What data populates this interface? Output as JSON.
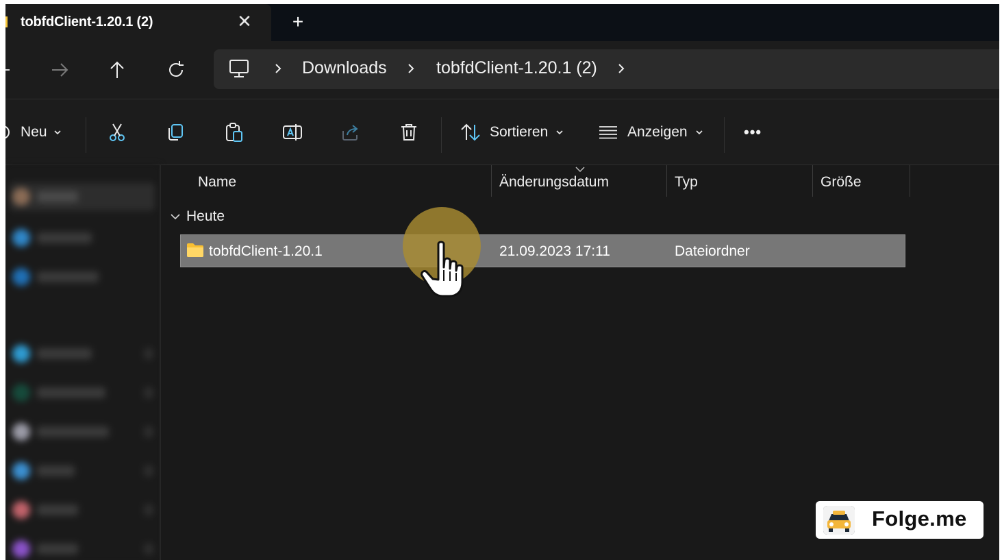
{
  "tab": {
    "title": "tobfdClient-1.20.1 (2)",
    "close_glyph": "✕",
    "new_tab_glyph": "+"
  },
  "breadcrumb": [
    "Downloads",
    "tobfdClient-1.20.1 (2)"
  ],
  "toolbar": {
    "new_label": "Neu",
    "sort_label": "Sortieren",
    "view_label": "Anzeigen",
    "more_glyph": "•••"
  },
  "columns": [
    "Name",
    "Änderungsdatum",
    "Typ",
    "Größe"
  ],
  "group": {
    "label": "Heute"
  },
  "rows": [
    {
      "name": "tobfdClient-1.20.1",
      "modified": "21.09.2023 17:11",
      "type": "Dateiordner",
      "size": ""
    }
  ],
  "watermark": {
    "text": "Folge.me"
  },
  "colors": {
    "background": "#191919",
    "tab_strip": "#0c1016",
    "selection": "#777777",
    "accent_blue": "#4cc2ff",
    "folder_yellow": "#ffc83d",
    "click_halo": "#aa8c32"
  },
  "icons": [
    "back-arrow-icon",
    "forward-arrow-icon",
    "up-arrow-icon",
    "refresh-icon",
    "computer-icon",
    "chevron-right-icon",
    "plus-circle-icon",
    "cut-icon",
    "copy-icon",
    "paste-icon",
    "rename-icon",
    "share-icon",
    "delete-icon",
    "sort-icon",
    "view-icon",
    "more-icon",
    "folder-icon",
    "hand-cursor-icon"
  ]
}
